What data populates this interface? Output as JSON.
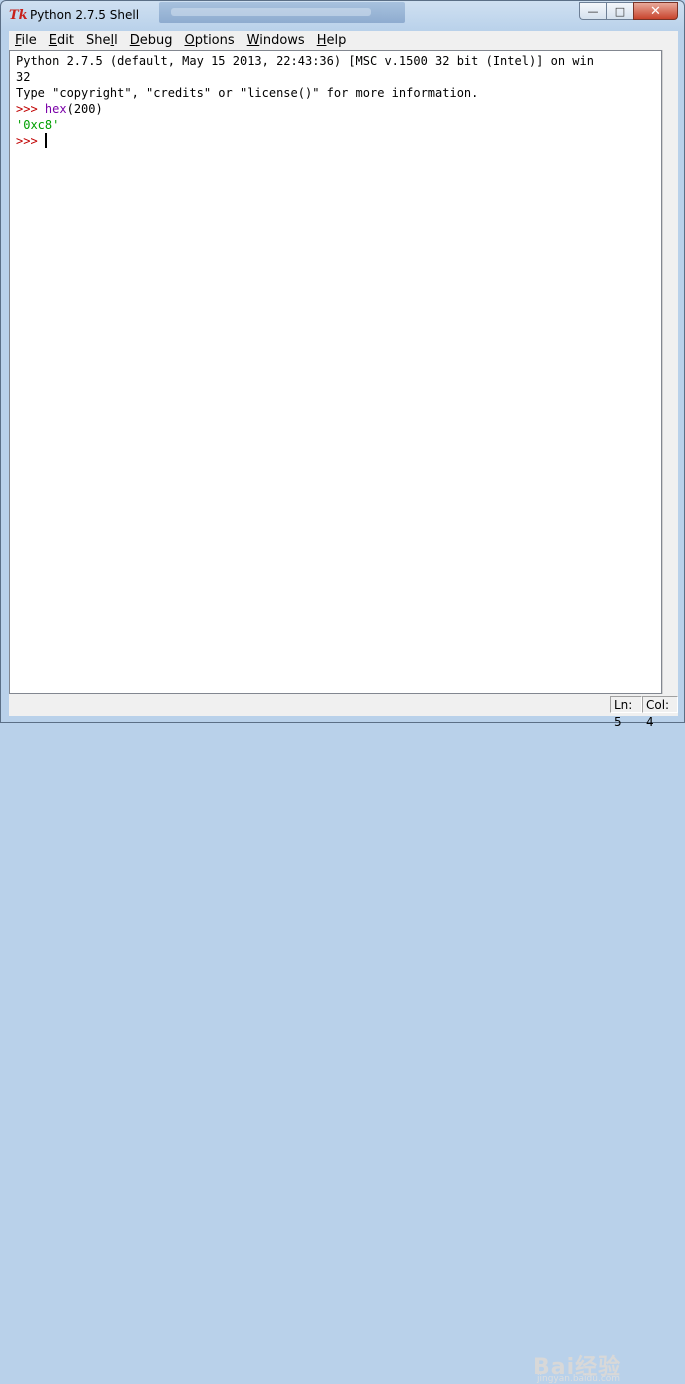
{
  "window": {
    "title": "Python 2.7.5 Shell",
    "icon": "tk-icon"
  },
  "menu": {
    "items": [
      {
        "label": "File",
        "u": "F",
        "rest": "ile"
      },
      {
        "label": "Edit",
        "u": "E",
        "rest": "dit"
      },
      {
        "label": "Shell",
        "pre": "She",
        "u": "l",
        "rest": "l"
      },
      {
        "label": "Debug",
        "u": "D",
        "rest": "ebug"
      },
      {
        "label": "Options",
        "u": "O",
        "rest": "ptions"
      },
      {
        "label": "Windows",
        "u": "W",
        "rest": "indows"
      },
      {
        "label": "Help",
        "u": "H",
        "rest": "elp"
      }
    ]
  },
  "shell": {
    "banner_line1": "Python 2.7.5 (default, May 15 2013, 22:43:36) [MSC v.1500 32 bit (Intel)] on win",
    "banner_line2": "32",
    "banner_line3": "Type \"copyright\", \"credits\" or \"license()\" for more information.",
    "prompt": ">>> ",
    "cmd_func": "hex",
    "cmd_args": "(200)",
    "output": "'0xc8'"
  },
  "status": {
    "ln": "Ln: 5",
    "col": "Col: 4"
  },
  "watermark": {
    "text": "Bai经验",
    "sub": "jingyan.baidu.com"
  },
  "colors": {
    "prompt": "#c00000",
    "builtin": "#7a00a8",
    "string": "#00a000"
  }
}
